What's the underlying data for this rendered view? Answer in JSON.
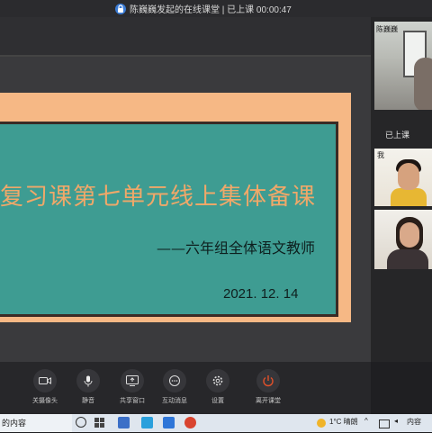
{
  "window": {
    "title": "陈巍巍发起的在线课堂 | 已上课 00:00:47"
  },
  "slide": {
    "title": "复习课第七单元线上集体备课",
    "subtitle": "——六年组全体语文教师",
    "date": "2021. 12. 14"
  },
  "participants": [
    {
      "name": "陈巍巍"
    },
    {
      "name": "我"
    },
    {
      "name": ""
    }
  ],
  "status_label": "已上课",
  "toolbar": {
    "buttons": [
      {
        "label": "关摄像头",
        "icon": "camera-icon"
      },
      {
        "label": "静音",
        "icon": "microphone-icon"
      },
      {
        "label": "共享窗口",
        "icon": "screen-share-icon"
      },
      {
        "label": "互动消息",
        "icon": "chat-icon"
      },
      {
        "label": "设置",
        "icon": "gear-icon"
      },
      {
        "label": "离开课堂",
        "icon": "power-icon"
      }
    ]
  },
  "taskbar": {
    "search_text": "的内容",
    "weather": "1°C 晴朗",
    "right_text": "内容"
  },
  "colors": {
    "slide_frame": "#f6b885",
    "slide_board": "#3e9c92",
    "slide_title": "#f0a869",
    "leave_button": "#e0502a"
  }
}
